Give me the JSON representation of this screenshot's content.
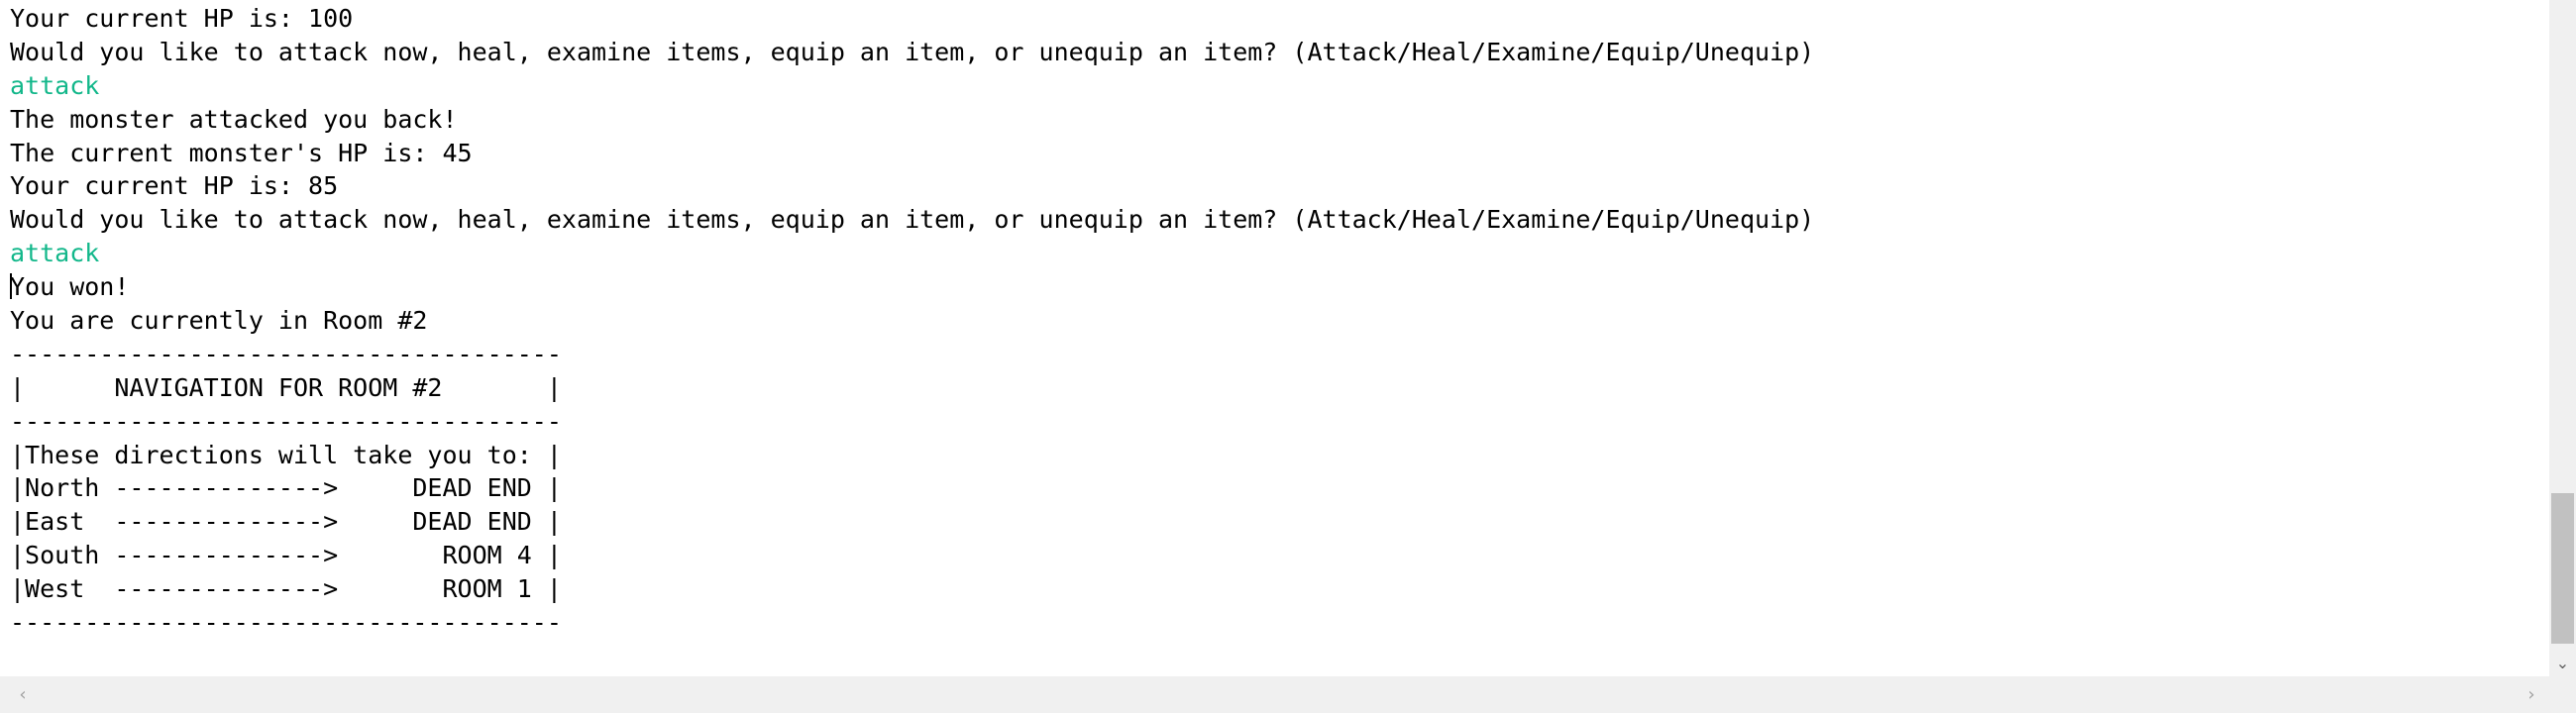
{
  "console": {
    "lines": [
      {
        "text": "Your current HP is: 100",
        "kind": "output"
      },
      {
        "text": "Would you like to attack now, heal, examine items, equip an item, or unequip an item? (Attack/Heal/Examine/Equip/Unequip)",
        "kind": "output"
      },
      {
        "text": "attack",
        "kind": "input"
      },
      {
        "text": "The monster attacked you back!",
        "kind": "output"
      },
      {
        "text": "The current monster's HP is: 45",
        "kind": "output"
      },
      {
        "text": "Your current HP is: 85",
        "kind": "output"
      },
      {
        "text": "Would you like to attack now, heal, examine items, equip an item, or unequip an item? (Attack/Heal/Examine/Equip/Unequip)",
        "kind": "output"
      },
      {
        "text": "attack",
        "kind": "input"
      },
      {
        "text": "You won!",
        "kind": "output"
      },
      {
        "text": "You are currently in Room #2",
        "kind": "output"
      },
      {
        "text": "-------------------------------------",
        "kind": "output"
      },
      {
        "text": "|      NAVIGATION FOR ROOM #2       |",
        "kind": "output"
      },
      {
        "text": "-------------------------------------",
        "kind": "output"
      },
      {
        "text": "|These directions will take you to: |",
        "kind": "output"
      },
      {
        "text": "|North -------------->     DEAD END |",
        "kind": "output"
      },
      {
        "text": "|East  -------------->     DEAD END |",
        "kind": "output"
      },
      {
        "text": "|South -------------->       ROOM 4 |",
        "kind": "output"
      },
      {
        "text": "|West  -------------->       ROOM 1 |",
        "kind": "output"
      },
      {
        "text": "-------------------------------------",
        "kind": "output"
      }
    ]
  },
  "colors": {
    "input_text": "#12b78a",
    "output_text": "#000000",
    "background": "#ffffff",
    "scrollbar_track": "#f0f0f0",
    "scrollbar_thumb": "#c1c1c1"
  },
  "icons": {
    "scroll_down": "chevron-down-icon",
    "scroll_left": "chevron-left-icon",
    "scroll_right": "chevron-right-icon"
  },
  "glyphs": {
    "down": "⌄",
    "left": "‹",
    "right": "›"
  }
}
